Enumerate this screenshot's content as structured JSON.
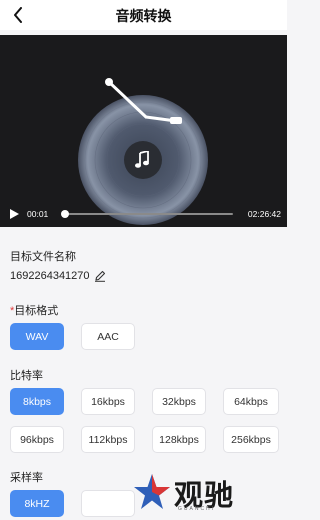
{
  "header": {
    "title": "音频转换"
  },
  "player": {
    "current_time": "00:01",
    "total_time": "02:26:42",
    "progress": 0.0
  },
  "file": {
    "section_label": "目标文件名称",
    "name": "1692264341270"
  },
  "format": {
    "required_mark": "*",
    "section_label": "目标格式",
    "options": [
      "WAV",
      "AAC"
    ],
    "selected": "WAV"
  },
  "bitrate": {
    "section_label": "比特率",
    "options": [
      "8kbps",
      "16kbps",
      "32kbps",
      "64kbps",
      "96kbps",
      "112kbps",
      "128kbps",
      "256kbps"
    ],
    "selected": "8kbps"
  },
  "samplerate": {
    "section_label": "采样率",
    "options": [
      "8kHZ"
    ],
    "selected": "8kHZ"
  },
  "watermark": {
    "text": "观驰",
    "subtext": "GUANCHI"
  },
  "colors": {
    "accent": "#4a8cf0",
    "required": "#e03a3a",
    "player_bg": "#1a1a1c"
  }
}
